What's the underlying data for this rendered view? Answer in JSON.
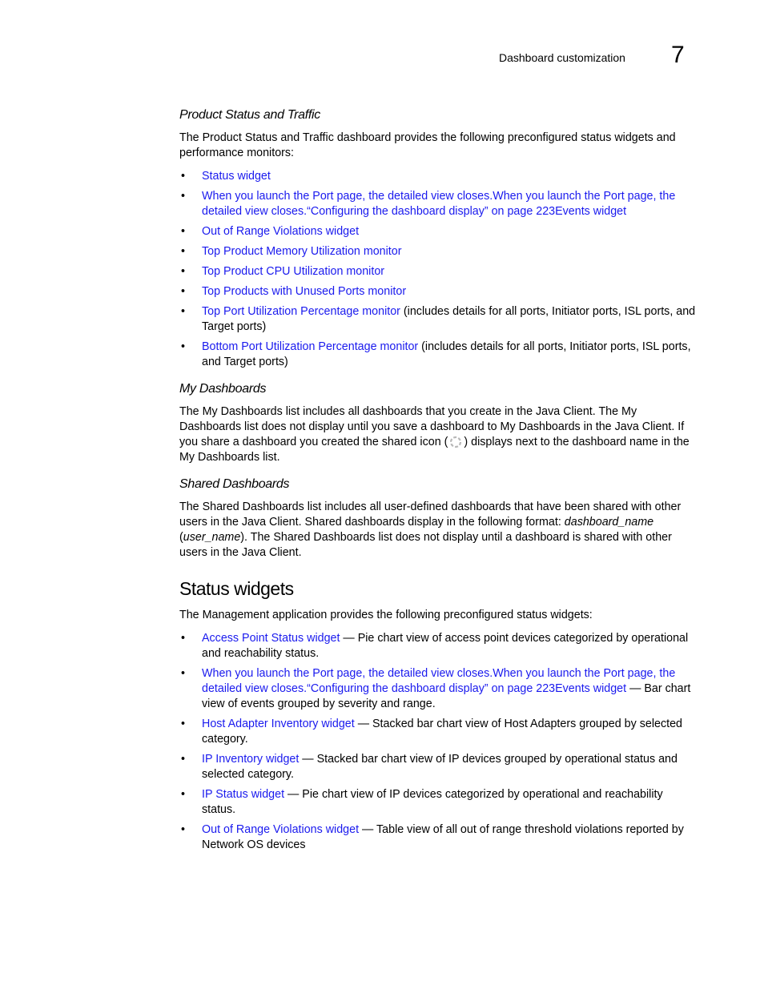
{
  "header": {
    "running_title": "Dashboard customization",
    "chapter_number": "7"
  },
  "product_status": {
    "heading": "Product Status and Traffic",
    "intro": "The Product Status and Traffic dashboard provides the following preconfigured status widgets and performance monitors:",
    "items": [
      {
        "link": "Status widget",
        "rest": ""
      },
      {
        "link": "When you launch the Port page, the detailed view closes.When you launch the Port page, the detailed view closes.“Configuring the dashboard display” on page 223Events widget",
        "rest": ""
      },
      {
        "link": "Out of Range Violations widget",
        "rest": ""
      },
      {
        "link": "Top Product Memory Utilization monitor",
        "rest": ""
      },
      {
        "link": "Top Product CPU Utilization monitor",
        "rest": ""
      },
      {
        "link": "Top Products with Unused Ports monitor",
        "rest": ""
      },
      {
        "link": "Top Port Utilization Percentage monitor",
        "rest": " (includes details for all ports, Initiator ports, ISL ports, and Target ports)"
      },
      {
        "link": "Bottom Port Utilization Percentage monitor",
        "rest": " (includes details for all ports, Initiator ports, ISL ports, and Target ports)"
      }
    ]
  },
  "my_dashboards": {
    "heading": "My Dashboards",
    "text_before_icon": "The My Dashboards list includes all dashboards that you create in the Java Client. The My Dashboards list does not display until you save a dashboard to My Dashboards in the Java Client. If you share a dashboard you created the shared icon (",
    "icon": "shared-icon",
    "text_after_icon": ") displays next to the dashboard name in the My Dashboards list."
  },
  "shared_dashboards": {
    "heading": "Shared Dashboards",
    "text_1": "The Shared Dashboards list includes all user-defined dashboards that have been shared with other users in the Java Client. Shared dashboards display in the following format: ",
    "italic_1": "dashboard_name",
    "text_2": " (",
    "italic_2": "user_name",
    "text_3": "). The Shared Dashboards list does not display until a dashboard is shared with other users in the Java Client."
  },
  "status_widgets": {
    "heading": "Status widgets",
    "intro": "The Management application provides the following preconfigured status widgets:",
    "items": [
      {
        "link": "Access Point Status widget",
        "rest": " — Pie chart view of access point devices categorized by operational and reachability status."
      },
      {
        "link": "When you launch the Port page, the detailed view closes.When you launch the Port page, the detailed view closes.“Configuring the dashboard display” on page 223Events widget",
        "rest": " — Bar chart view of events grouped by severity and range."
      },
      {
        "link": "Host Adapter Inventory widget",
        "rest": " — Stacked bar chart view of Host Adapters grouped by selected category."
      },
      {
        "link": "IP Inventory widget",
        "rest": " — Stacked bar chart view of IP devices grouped by operational status and selected category."
      },
      {
        "link": "IP Status widget",
        "rest": " — Pie chart view of IP devices categorized by operational and reachability status."
      },
      {
        "link": "Out of Range Violations widget",
        "rest": " — Table view of all out of range threshold violations reported by Network OS devices"
      }
    ]
  },
  "bullet_char": "•"
}
